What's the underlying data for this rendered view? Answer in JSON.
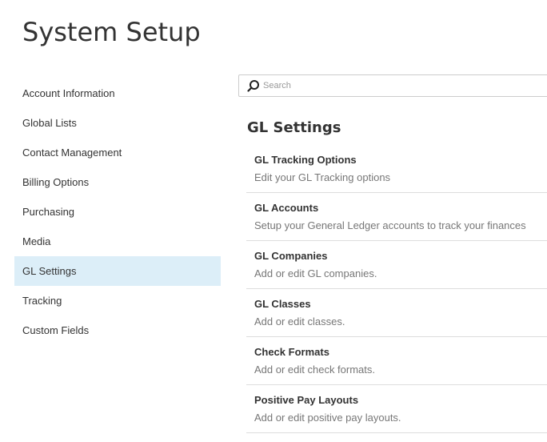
{
  "page": {
    "title": "System Setup"
  },
  "sidebar": {
    "items": [
      {
        "label": "Account Information"
      },
      {
        "label": "Global Lists"
      },
      {
        "label": "Contact Management"
      },
      {
        "label": "Billing Options"
      },
      {
        "label": "Purchasing"
      },
      {
        "label": "Media"
      },
      {
        "label": "GL Settings",
        "active": true
      },
      {
        "label": "Tracking"
      },
      {
        "label": "Custom Fields"
      }
    ]
  },
  "search": {
    "placeholder": "Search",
    "value": ""
  },
  "main": {
    "section_title": "GL Settings",
    "items": [
      {
        "title": "GL Tracking Options",
        "description": "Edit your GL Tracking options"
      },
      {
        "title": "GL Accounts",
        "description": "Setup your General Ledger accounts to track your finances"
      },
      {
        "title": "GL Companies",
        "description": "Add or edit GL companies."
      },
      {
        "title": "GL Classes",
        "description": "Add or edit classes."
      },
      {
        "title": "Check Formats",
        "description": "Add or edit check formats."
      },
      {
        "title": "Positive Pay Layouts",
        "description": "Add or edit positive pay layouts."
      }
    ]
  },
  "colors": {
    "active_item_bg": "#dceef8",
    "text": "#333333",
    "muted_text": "#777777",
    "divider": "#dddddd"
  },
  "icons": {
    "search": "search-icon"
  }
}
